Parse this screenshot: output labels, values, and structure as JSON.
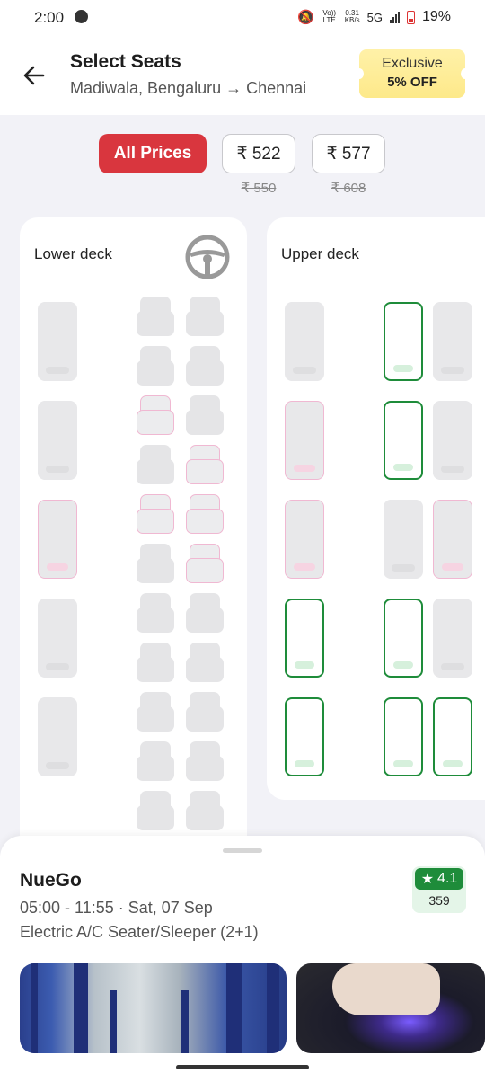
{
  "status_bar": {
    "time": "2:00",
    "volte": "Vo)) LTE",
    "speed_value": "0.31",
    "speed_unit": "KB/s",
    "network": "5G",
    "battery": "19%"
  },
  "header": {
    "title": "Select Seats",
    "route": "Madiwala, Bengaluru → Chennai",
    "offer_line1": "Exclusive",
    "offer_line2": "5% OFF"
  },
  "price_filters": [
    {
      "label": "All Prices",
      "active": true
    },
    {
      "label": "₹ 522",
      "original": "₹ 550"
    },
    {
      "label": "₹ 577",
      "original": "₹ 608"
    }
  ],
  "decks": {
    "lower": {
      "title": "Lower deck"
    },
    "upper": {
      "title": "Upper deck"
    }
  },
  "bus": {
    "operator": "NueGo",
    "timing": "05:00 - 11:55 · Sat, 07 Sep",
    "type": "Electric A/C Seater/Sleeper (2+1)",
    "rating": "4.1",
    "rating_count": "359"
  },
  "colors": {
    "accent": "#d9363e",
    "available": "#1e8c3a",
    "ladies": "#f0b8d2",
    "booked": "#e8e8ea"
  }
}
